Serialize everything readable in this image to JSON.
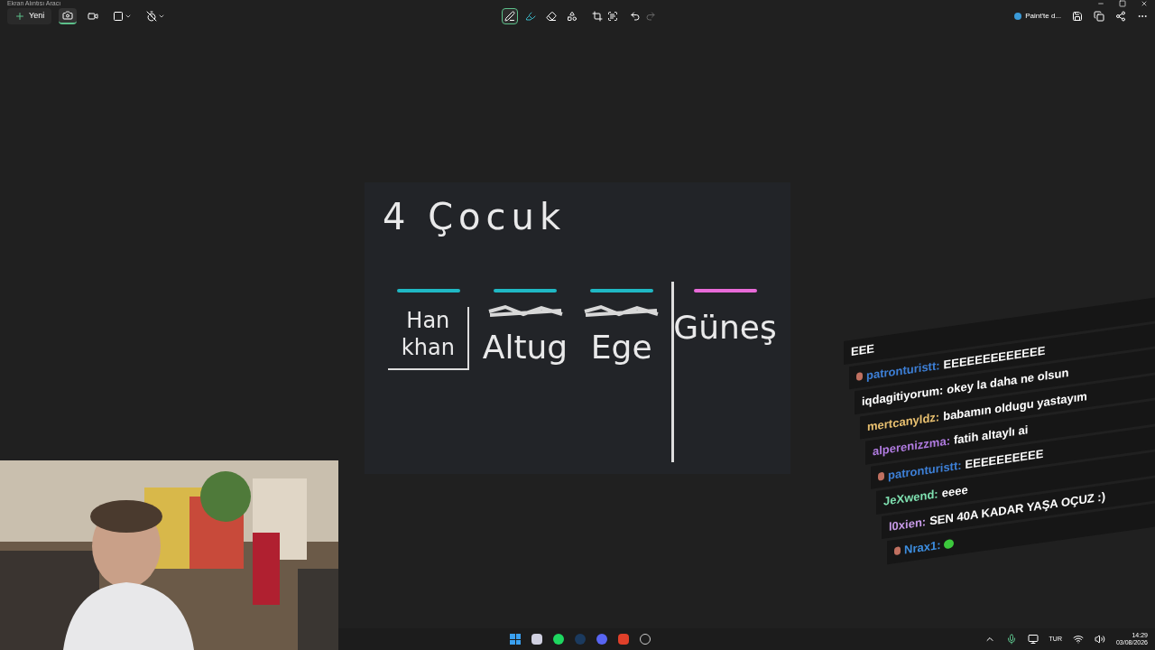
{
  "window": {
    "title": "Ekran Alıntısı Aracı"
  },
  "toolbar": {
    "new_button": "Yeni",
    "capture_modes": [
      {
        "kind": "camera",
        "selected": true
      },
      {
        "kind": "video",
        "selected": false
      }
    ],
    "paint_button": "Paint'te d..."
  },
  "pen_tools": [
    {
      "kind": "pen",
      "selected": true
    },
    {
      "kind": "highlighter",
      "selected": false
    },
    {
      "kind": "eraser",
      "selected": false
    },
    {
      "kind": "shapes",
      "selected": false
    }
  ],
  "drawing": {
    "title": "4 Çocuk",
    "columns": [
      {
        "name": "Han khan",
        "color": "#1fb8c4",
        "struck": false,
        "boxed": true
      },
      {
        "name": "Altug",
        "color": "#1fb8c4",
        "struck": true,
        "boxed": false
      },
      {
        "name": "Ege",
        "color": "#1fb8c4",
        "struck": true,
        "boxed": false
      },
      {
        "name": "Güneş",
        "color": "#e86ad8",
        "struck": false,
        "boxed": false
      }
    ]
  },
  "chat": [
    {
      "message": "EEE",
      "badge": false
    },
    {
      "user": "patronturistt:",
      "message": "EEEEEEEEEEEEE",
      "color": "#3d7fd6",
      "badge": true
    },
    {
      "user": "iqdagitiyorum:",
      "message": "okey la daha ne olsun",
      "color": "#ffffff",
      "badge": false
    },
    {
      "user": "mertcanyldz:",
      "message": "babamın oldugu yastayım",
      "color": "#e8c070",
      "badge": false
    },
    {
      "user": "alperenizzma:",
      "message": "fatih altaylı ai",
      "color": "#b07be0",
      "badge": false
    },
    {
      "user": "patronturistt:",
      "message": "EEEEEEEEEE",
      "color": "#3d7fd6",
      "badge": true
    },
    {
      "user": "JeXwend:",
      "message": "eeee",
      "color": "#7fe0b0",
      "badge": false
    },
    {
      "user": "l0xien:",
      "message": "SEN 40A KADAR YAŞA OÇUZ :)",
      "color": "#c89be8",
      "badge": false
    },
    {
      "user": "Nrax1:",
      "color": "#3d8ee0",
      "badge": true
    }
  ],
  "taskbar": {
    "language": "TUR",
    "time": "14:29",
    "date": "03/08/2026"
  }
}
